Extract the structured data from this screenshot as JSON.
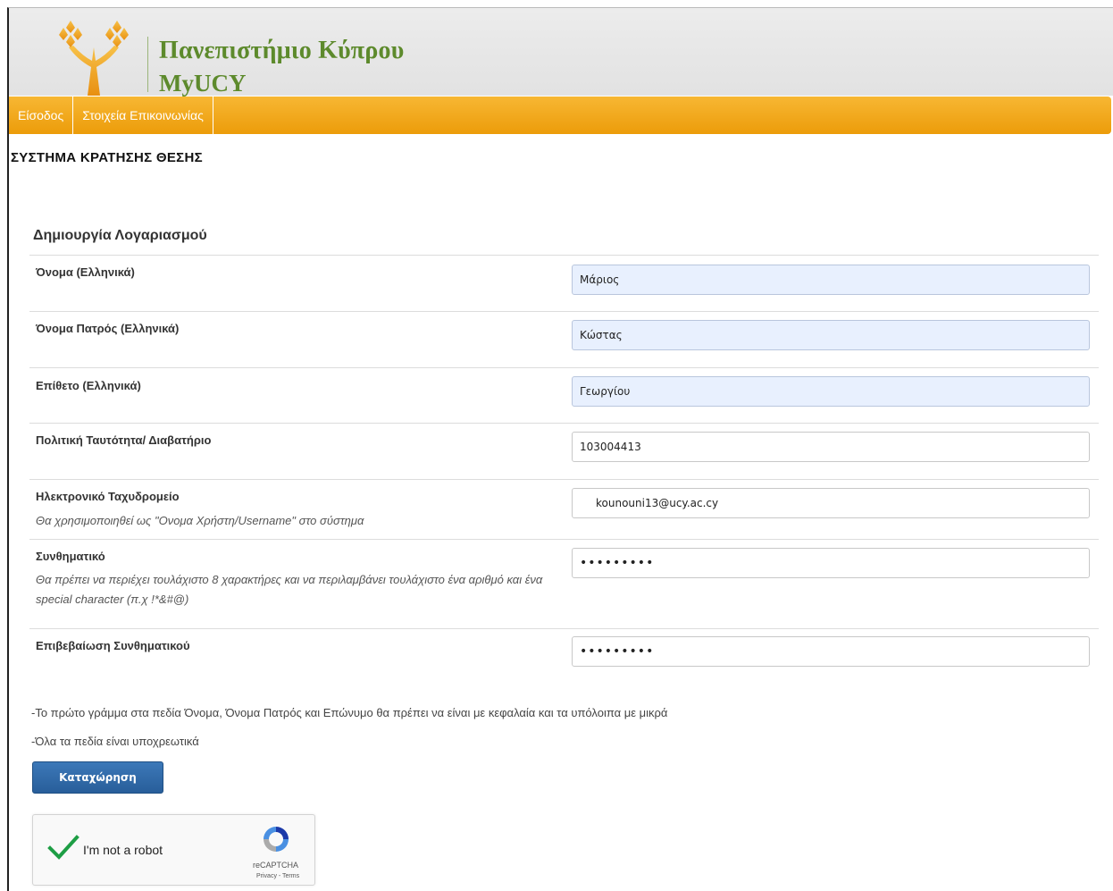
{
  "header": {
    "university_name": "Πανεπιστήμιο Κύπρου",
    "portal_name": "MyUCY",
    "brand_color": "#5d8a2c",
    "logo_icon": "carob-tree-logo-icon"
  },
  "nav": {
    "items": [
      "Είσοδος",
      "Στοιχεία Επικοινωνίας"
    ],
    "color": "#f2a51d"
  },
  "page": {
    "heading": "ΣΥΣΤΗΜΑ ΚΡΑΤΗΣΗΣ ΘΕΣΗΣ",
    "section_title": "Δημιουργία Λογαριασμού"
  },
  "form": {
    "fields": [
      {
        "label": "Όνομα (Ελληνικά)",
        "value": "Μάριος"
      },
      {
        "label": "Όνομα Πατρός (Ελληνικά)",
        "value": "Κώστας"
      },
      {
        "label": "Επίθετο (Ελληνικά)",
        "value": "Γεωργίου"
      },
      {
        "label": "Πολιτική Ταυτότητα/ Διαβατήριο",
        "value": "103004413"
      },
      {
        "label": "Ηλεκτρονικό Ταχυδρομείο",
        "help": "Θα χρησιμοποιηθεί ως \"Ονομα Χρήστη/Username\" στο σύστημα",
        "value": "kounouni13@ucy.ac.cy"
      },
      {
        "label": "Συνθηματικό",
        "help": "Θα πρέπει να περιέχει τουλάχιστο 8 χαρακτήρες και να περιλαμβάνει τουλάχιστο ένα αριθμό και ένα special character (π.χ !*&#@)",
        "value": "•••••••••"
      },
      {
        "label": "Επιβεβαίωση Συνθηματικού",
        "value": "•••••••••"
      }
    ]
  },
  "notes": [
    "-Το πρώτο γράμμα στα πεδία Όνομα, Όνομα Πατρός και Επώνυμο θα πρέπει να είναι με κεφαλαία και τα υπόλοιπα με μικρά",
    "-Όλα τα πεδία είναι υποχρεωτικά"
  ],
  "submit_label": "Καταχώρηση",
  "captcha": {
    "label": "I'm not a robot",
    "brand": "reCAPTCHA",
    "links": "Privacy - Terms",
    "checked": true
  }
}
